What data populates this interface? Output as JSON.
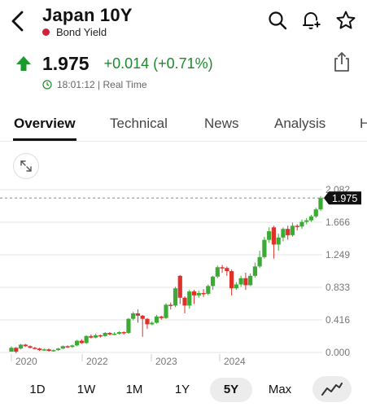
{
  "header": {
    "title": "Japan 10Y",
    "subtitle": "Bond Yield",
    "icons": [
      "chevron-left-icon",
      "search-icon",
      "bell-plus-icon",
      "star-icon"
    ]
  },
  "quote": {
    "price": "1.975",
    "change": "+0.014 (+0.71%)",
    "time": "18:01:12 | Real Time",
    "change_color": "#1d8a2e",
    "direction": "up"
  },
  "tabs": [
    {
      "label": "Overview",
      "active": true
    },
    {
      "label": "Technical"
    },
    {
      "label": "News"
    },
    {
      "label": "Analysis"
    },
    {
      "label": "H"
    }
  ],
  "chart_data": {
    "type": "candlestick",
    "y_ticks": [
      "2.082",
      "1.666",
      "1.249",
      "0.833",
      "0.416",
      "0.000"
    ],
    "ylim": [
      0,
      2.082
    ],
    "x_labels": [
      "2020",
      "2022",
      "2023",
      "2024"
    ],
    "current_value": "1.975",
    "current_value_num": 1.975,
    "up_color": "#3cab35",
    "down_color": "#e0302a",
    "candles": [
      [
        0.01,
        0.06,
        0.08,
        0.01
      ],
      [
        0.06,
        0.01,
        0.07,
        -0.01
      ],
      [
        0.05,
        0.1,
        0.11,
        0.04
      ],
      [
        0.1,
        0.08,
        0.11,
        0.07
      ],
      [
        0.08,
        0.06,
        0.09,
        0.05
      ],
      [
        0.06,
        0.05,
        0.07,
        0.04
      ],
      [
        0.05,
        0.03,
        0.06,
        0.02
      ],
      [
        0.03,
        0.04,
        0.05,
        0.02
      ],
      [
        0.04,
        0.02,
        0.05,
        0.01
      ],
      [
        0.02,
        0.03,
        0.04,
        0.01
      ],
      [
        0.03,
        0.05,
        0.06,
        0.02
      ],
      [
        0.05,
        0.08,
        0.09,
        0.04
      ],
      [
        0.08,
        0.07,
        0.09,
        0.06
      ],
      [
        0.07,
        0.09,
        0.1,
        0.06
      ],
      [
        0.09,
        0.15,
        0.16,
        0.08
      ],
      [
        0.15,
        0.12,
        0.17,
        0.11
      ],
      [
        0.12,
        0.21,
        0.22,
        0.11
      ],
      [
        0.21,
        0.19,
        0.23,
        0.18
      ],
      [
        0.19,
        0.22,
        0.24,
        0.18
      ],
      [
        0.22,
        0.21,
        0.23,
        0.19
      ],
      [
        0.21,
        0.25,
        0.26,
        0.2
      ],
      [
        0.25,
        0.23,
        0.26,
        0.22
      ],
      [
        0.23,
        0.24,
        0.26,
        0.22
      ],
      [
        0.24,
        0.26,
        0.27,
        0.23
      ],
      [
        0.26,
        0.25,
        0.27,
        0.23
      ],
      [
        0.25,
        0.43,
        0.44,
        0.24
      ],
      [
        0.43,
        0.5,
        0.52,
        0.41
      ],
      [
        0.5,
        0.47,
        0.55,
        0.38
      ],
      [
        0.47,
        0.43,
        0.48,
        0.2
      ],
      [
        0.43,
        0.36,
        0.44,
        0.3
      ],
      [
        0.36,
        0.38,
        0.4,
        0.35
      ],
      [
        0.38,
        0.46,
        0.48,
        0.37
      ],
      [
        0.46,
        0.44,
        0.47,
        0.42
      ],
      [
        0.44,
        0.61,
        0.63,
        0.43
      ],
      [
        0.61,
        0.6,
        0.64,
        0.55
      ],
      [
        0.6,
        0.82,
        0.84,
        0.58
      ],
      [
        0.98,
        0.7,
        0.99,
        0.62
      ],
      [
        0.7,
        0.6,
        0.72,
        0.5
      ],
      [
        0.6,
        0.78,
        0.8,
        0.56
      ],
      [
        0.78,
        0.73,
        0.8,
        0.62
      ],
      [
        0.73,
        0.76,
        0.79,
        0.7
      ],
      [
        0.76,
        0.75,
        0.81,
        0.71
      ],
      [
        0.75,
        0.85,
        0.87,
        0.73
      ],
      [
        0.85,
        0.97,
        0.98,
        0.8
      ],
      [
        0.97,
        1.09,
        1.11,
        0.95
      ],
      [
        1.09,
        1.08,
        1.12,
        1.02
      ],
      [
        1.08,
        1.04,
        1.1,
        0.98
      ],
      [
        1.04,
        0.82,
        1.06,
        0.73
      ],
      [
        0.82,
        0.87,
        0.9,
        0.8
      ],
      [
        0.87,
        0.95,
        0.98,
        0.84
      ],
      [
        0.95,
        0.86,
        1.02,
        0.8
      ],
      [
        0.86,
        0.98,
        1.01,
        0.85
      ],
      [
        0.98,
        1.1,
        1.15,
        0.96
      ],
      [
        1.1,
        1.22,
        1.3,
        1.08
      ],
      [
        1.22,
        1.44,
        1.48,
        1.2
      ],
      [
        1.44,
        1.55,
        1.6,
        1.4
      ],
      [
        1.6,
        1.38,
        1.62,
        1.2
      ],
      [
        1.38,
        1.47,
        1.52,
        1.3
      ],
      [
        1.47,
        1.58,
        1.6,
        1.42
      ],
      [
        1.58,
        1.5,
        1.62,
        1.44
      ],
      [
        1.5,
        1.62,
        1.66,
        1.48
      ],
      [
        1.62,
        1.61,
        1.64,
        1.56
      ],
      [
        1.61,
        1.67,
        1.7,
        1.58
      ],
      [
        1.67,
        1.69,
        1.72,
        1.64
      ],
      [
        1.69,
        1.74,
        1.76,
        1.67
      ],
      [
        1.74,
        1.83,
        1.85,
        1.72
      ],
      [
        1.83,
        1.975,
        2.0,
        1.81
      ]
    ]
  },
  "ranges": [
    {
      "label": "1D"
    },
    {
      "label": "1W"
    },
    {
      "label": "1M"
    },
    {
      "label": "1Y"
    },
    {
      "label": "5Y",
      "active": true
    },
    {
      "label": "Max"
    }
  ],
  "chart_type_icon": "line-chart-icon"
}
